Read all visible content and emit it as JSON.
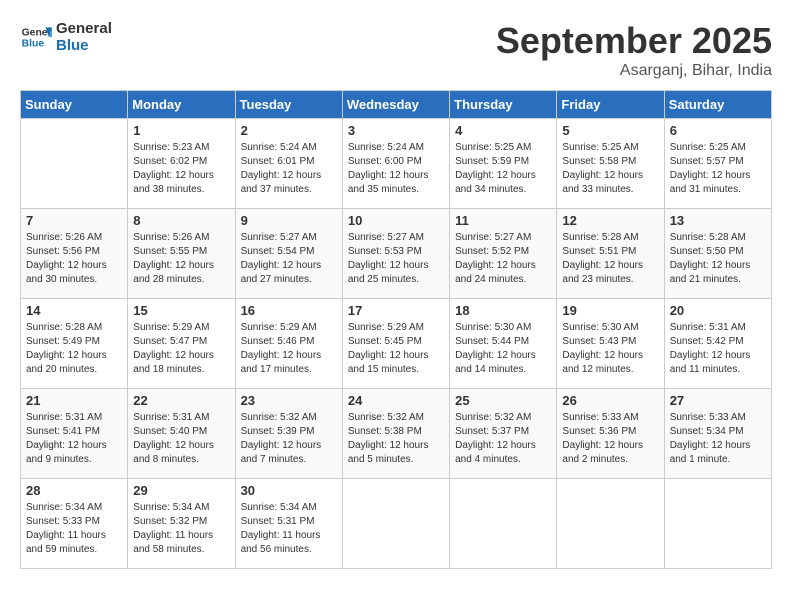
{
  "header": {
    "logo_line1": "General",
    "logo_line2": "Blue",
    "month": "September 2025",
    "location": "Asarganj, Bihar, India"
  },
  "days_of_week": [
    "Sunday",
    "Monday",
    "Tuesday",
    "Wednesday",
    "Thursday",
    "Friday",
    "Saturday"
  ],
  "weeks": [
    [
      {
        "day": "",
        "info": ""
      },
      {
        "day": "1",
        "info": "Sunrise: 5:23 AM\nSunset: 6:02 PM\nDaylight: 12 hours\nand 38 minutes."
      },
      {
        "day": "2",
        "info": "Sunrise: 5:24 AM\nSunset: 6:01 PM\nDaylight: 12 hours\nand 37 minutes."
      },
      {
        "day": "3",
        "info": "Sunrise: 5:24 AM\nSunset: 6:00 PM\nDaylight: 12 hours\nand 35 minutes."
      },
      {
        "day": "4",
        "info": "Sunrise: 5:25 AM\nSunset: 5:59 PM\nDaylight: 12 hours\nand 34 minutes."
      },
      {
        "day": "5",
        "info": "Sunrise: 5:25 AM\nSunset: 5:58 PM\nDaylight: 12 hours\nand 33 minutes."
      },
      {
        "day": "6",
        "info": "Sunrise: 5:25 AM\nSunset: 5:57 PM\nDaylight: 12 hours\nand 31 minutes."
      }
    ],
    [
      {
        "day": "7",
        "info": "Sunrise: 5:26 AM\nSunset: 5:56 PM\nDaylight: 12 hours\nand 30 minutes."
      },
      {
        "day": "8",
        "info": "Sunrise: 5:26 AM\nSunset: 5:55 PM\nDaylight: 12 hours\nand 28 minutes."
      },
      {
        "day": "9",
        "info": "Sunrise: 5:27 AM\nSunset: 5:54 PM\nDaylight: 12 hours\nand 27 minutes."
      },
      {
        "day": "10",
        "info": "Sunrise: 5:27 AM\nSunset: 5:53 PM\nDaylight: 12 hours\nand 25 minutes."
      },
      {
        "day": "11",
        "info": "Sunrise: 5:27 AM\nSunset: 5:52 PM\nDaylight: 12 hours\nand 24 minutes."
      },
      {
        "day": "12",
        "info": "Sunrise: 5:28 AM\nSunset: 5:51 PM\nDaylight: 12 hours\nand 23 minutes."
      },
      {
        "day": "13",
        "info": "Sunrise: 5:28 AM\nSunset: 5:50 PM\nDaylight: 12 hours\nand 21 minutes."
      }
    ],
    [
      {
        "day": "14",
        "info": "Sunrise: 5:28 AM\nSunset: 5:49 PM\nDaylight: 12 hours\nand 20 minutes."
      },
      {
        "day": "15",
        "info": "Sunrise: 5:29 AM\nSunset: 5:47 PM\nDaylight: 12 hours\nand 18 minutes."
      },
      {
        "day": "16",
        "info": "Sunrise: 5:29 AM\nSunset: 5:46 PM\nDaylight: 12 hours\nand 17 minutes."
      },
      {
        "day": "17",
        "info": "Sunrise: 5:29 AM\nSunset: 5:45 PM\nDaylight: 12 hours\nand 15 minutes."
      },
      {
        "day": "18",
        "info": "Sunrise: 5:30 AM\nSunset: 5:44 PM\nDaylight: 12 hours\nand 14 minutes."
      },
      {
        "day": "19",
        "info": "Sunrise: 5:30 AM\nSunset: 5:43 PM\nDaylight: 12 hours\nand 12 minutes."
      },
      {
        "day": "20",
        "info": "Sunrise: 5:31 AM\nSunset: 5:42 PM\nDaylight: 12 hours\nand 11 minutes."
      }
    ],
    [
      {
        "day": "21",
        "info": "Sunrise: 5:31 AM\nSunset: 5:41 PM\nDaylight: 12 hours\nand 9 minutes."
      },
      {
        "day": "22",
        "info": "Sunrise: 5:31 AM\nSunset: 5:40 PM\nDaylight: 12 hours\nand 8 minutes."
      },
      {
        "day": "23",
        "info": "Sunrise: 5:32 AM\nSunset: 5:39 PM\nDaylight: 12 hours\nand 7 minutes."
      },
      {
        "day": "24",
        "info": "Sunrise: 5:32 AM\nSunset: 5:38 PM\nDaylight: 12 hours\nand 5 minutes."
      },
      {
        "day": "25",
        "info": "Sunrise: 5:32 AM\nSunset: 5:37 PM\nDaylight: 12 hours\nand 4 minutes."
      },
      {
        "day": "26",
        "info": "Sunrise: 5:33 AM\nSunset: 5:36 PM\nDaylight: 12 hours\nand 2 minutes."
      },
      {
        "day": "27",
        "info": "Sunrise: 5:33 AM\nSunset: 5:34 PM\nDaylight: 12 hours\nand 1 minute."
      }
    ],
    [
      {
        "day": "28",
        "info": "Sunrise: 5:34 AM\nSunset: 5:33 PM\nDaylight: 11 hours\nand 59 minutes."
      },
      {
        "day": "29",
        "info": "Sunrise: 5:34 AM\nSunset: 5:32 PM\nDaylight: 11 hours\nand 58 minutes."
      },
      {
        "day": "30",
        "info": "Sunrise: 5:34 AM\nSunset: 5:31 PM\nDaylight: 11 hours\nand 56 minutes."
      },
      {
        "day": "",
        "info": ""
      },
      {
        "day": "",
        "info": ""
      },
      {
        "day": "",
        "info": ""
      },
      {
        "day": "",
        "info": ""
      }
    ]
  ]
}
